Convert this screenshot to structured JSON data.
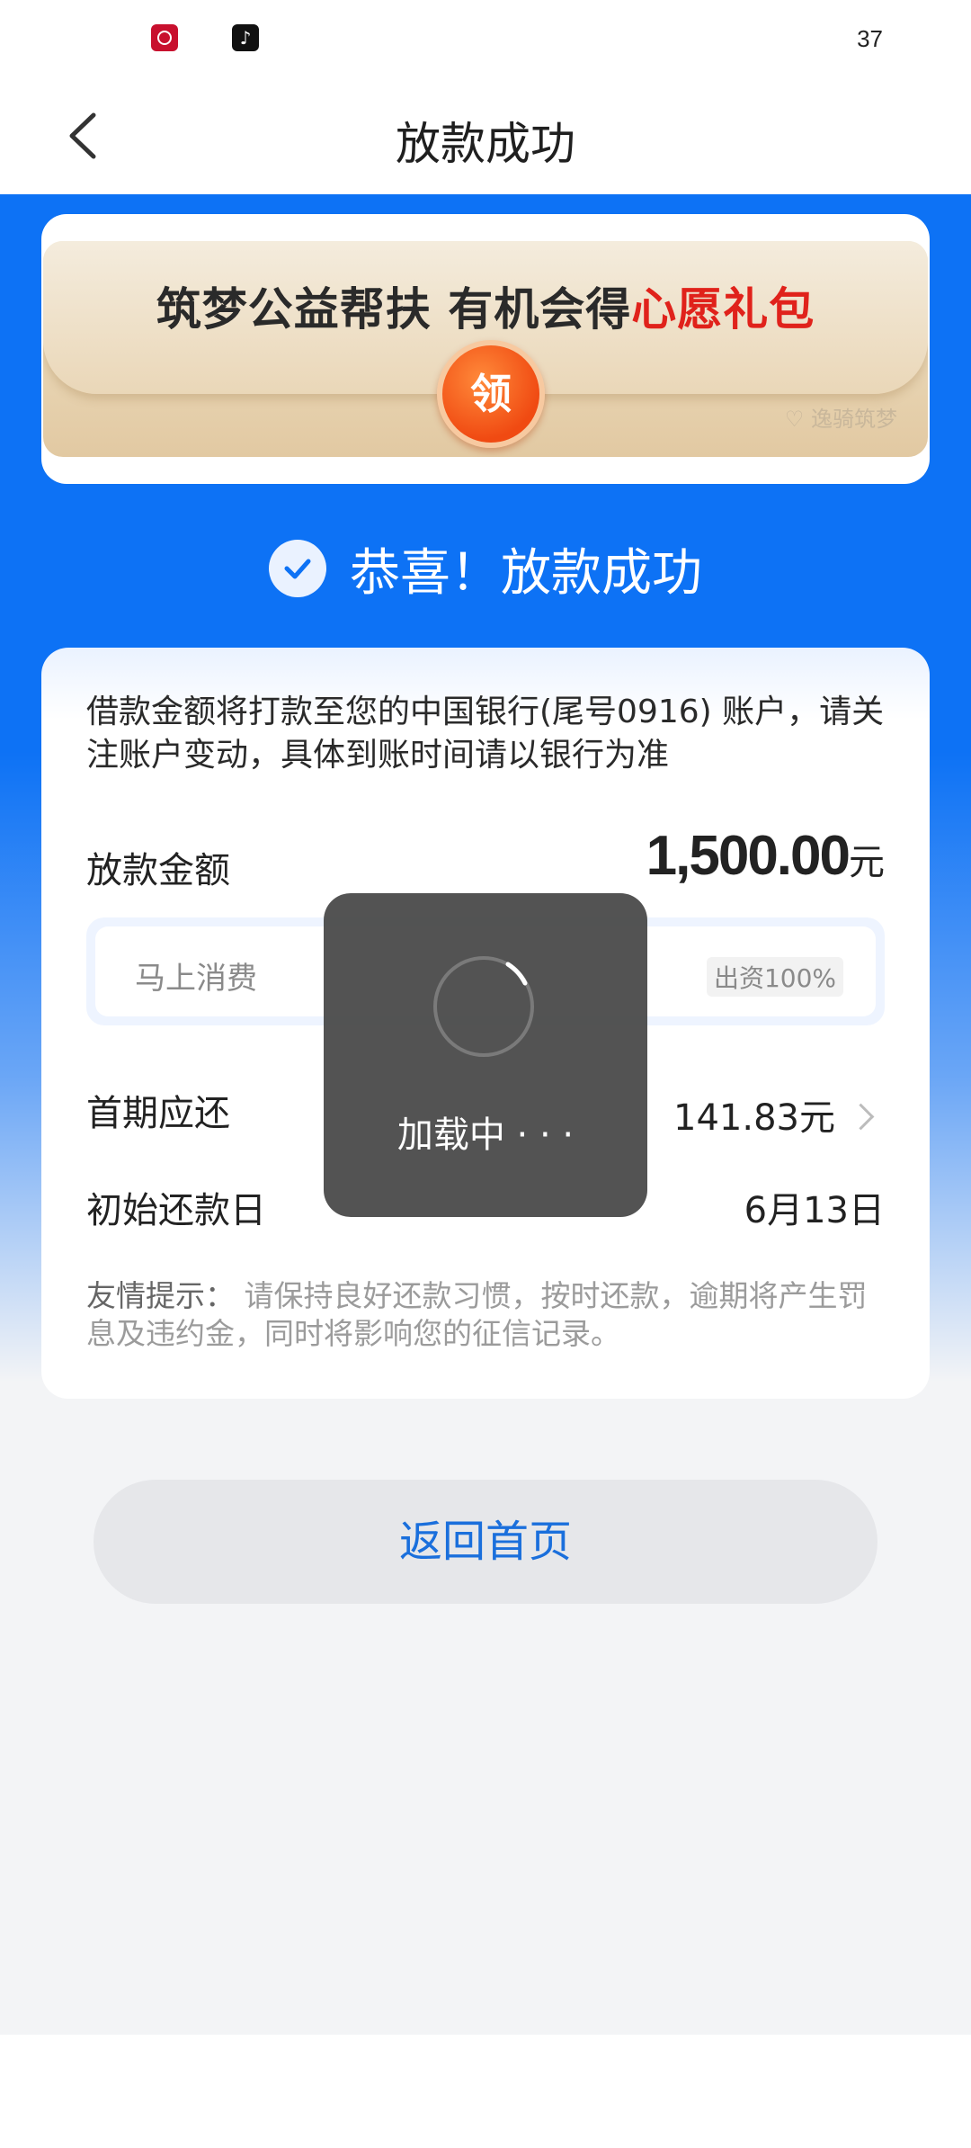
{
  "status_bar": {
    "battery": "37"
  },
  "nav": {
    "title": "放款成功"
  },
  "banner": {
    "text_main": "筑梦公益帮扶 有机会得",
    "text_highlight": "心愿礼包",
    "claim_label": "领",
    "logo": "♡ 逸骑筑梦"
  },
  "success": {
    "message": "恭喜！放款成功"
  },
  "card": {
    "notice": "借款金额将打款至您的中国银行(尾号0916) 账户，请关注账户变动，具体到账时间请以银行为准",
    "loan_amount_label": "放款金额",
    "loan_amount_value": "1,500.00",
    "loan_amount_unit": "元",
    "lender_name": "马上消费",
    "lender_share": "出资100%",
    "first_payment_label": "首期应还",
    "first_payment_value": "141.83元",
    "first_date_label": "初始还款日",
    "first_date_value": "6月13日",
    "tip_head": "友情提示：",
    "tip_body": " 请保持良好还款习惯，按时还款，逾期将产生罚息及违约金，同时将影响您的征信记录。"
  },
  "actions": {
    "home_label": "返回首页"
  },
  "loading": {
    "text": "加载中 · · ·"
  },
  "colors": {
    "primary_blue": "#0d72f5",
    "highlight_red": "#e0221b",
    "button_text_blue": "#1a6fdc"
  },
  "icons": {
    "back": "chevron-left-icon",
    "check": "check-circle-icon",
    "forward": "chevron-right-icon",
    "spinner": "loading-spinner-icon"
  }
}
